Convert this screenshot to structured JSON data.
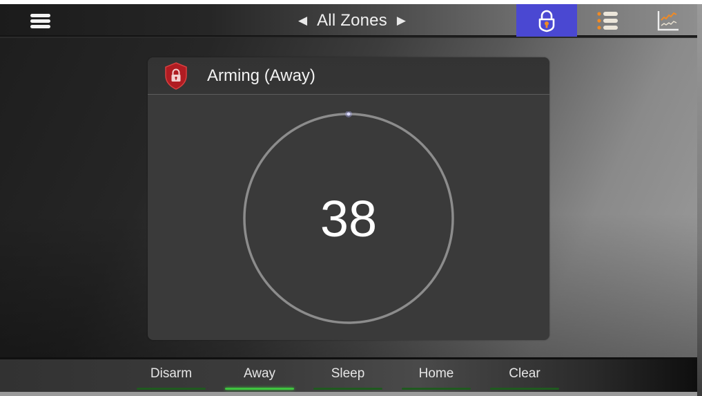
{
  "header": {
    "menu_icon": "hamburger-menu-icon",
    "zone_prev_icon": "◀",
    "zone_title": "All Zones",
    "zone_next_icon": "▶",
    "icons": [
      {
        "name": "security-lock-icon",
        "active": true
      },
      {
        "name": "zone-list-icon",
        "active": false
      },
      {
        "name": "history-chart-icon",
        "active": false
      }
    ]
  },
  "status_card": {
    "icon": "shield-lock-icon",
    "title": "Arming (Away)",
    "countdown_value": "38"
  },
  "modes": {
    "items": [
      {
        "label": "Disarm",
        "active": false
      },
      {
        "label": "Away",
        "active": true
      },
      {
        "label": "Sleep",
        "active": false
      },
      {
        "label": "Home",
        "active": false
      },
      {
        "label": "Clear",
        "active": false
      }
    ]
  },
  "colors": {
    "active_tab": "#4a48d2",
    "icon_accent": "#f08a24",
    "shield_red": "#b01c22",
    "mode_active": "#3fc43f",
    "mode_inactive": "#1f5a1f",
    "dial_ring": "#8a8a8a",
    "dial_dot": "#c8c8ff"
  }
}
